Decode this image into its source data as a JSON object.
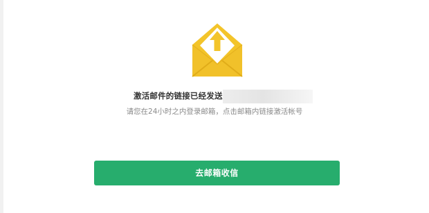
{
  "headline": {
    "text": "激活邮件的链接已经发送至"
  },
  "instruction": {
    "text": "请您在24小时之内登录邮箱，点击邮箱内链接激活帐号"
  },
  "action_button": {
    "label": "去邮箱收信"
  },
  "icons": {
    "envelope": "envelope-upload-icon"
  },
  "colors": {
    "envelope_yellow": "#f3c42a",
    "envelope_dark": "#e0ac19",
    "button_green": "#27ad6d"
  }
}
